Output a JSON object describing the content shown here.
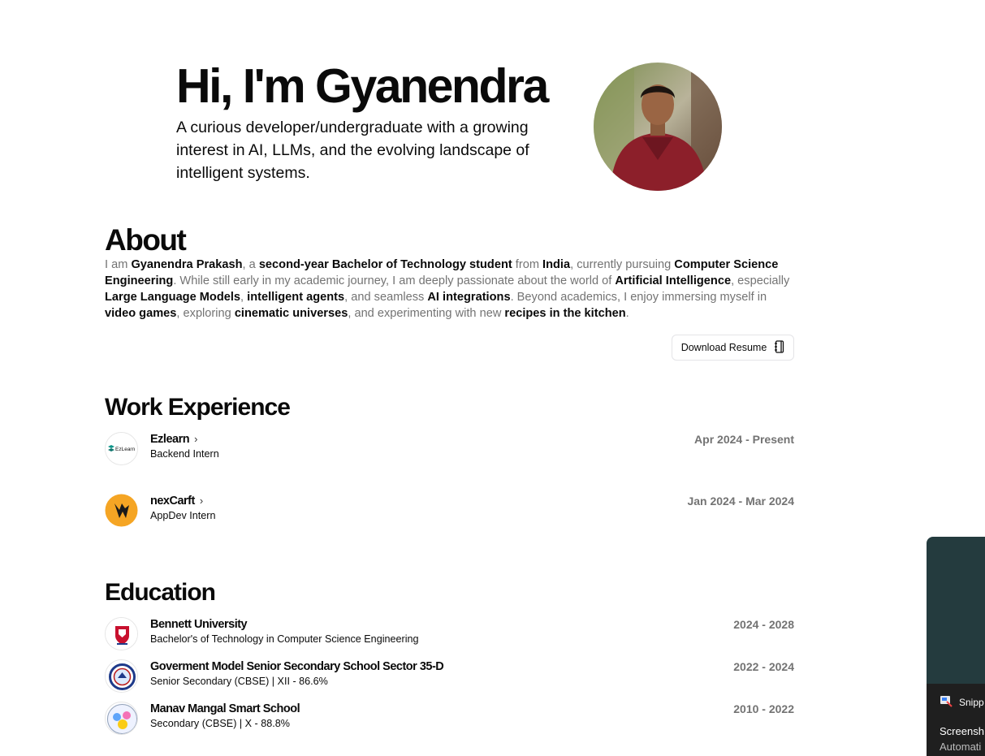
{
  "hero": {
    "title": "Hi, I'm Gyanendra",
    "subtitle": "A curious developer/undergraduate with a growing interest in AI, LLMs, and the evolving landscape of intelligent systems."
  },
  "about": {
    "title": "About",
    "segments": [
      {
        "text": "I am ",
        "bold": false
      },
      {
        "text": "Gyanendra Prakash",
        "bold": true
      },
      {
        "text": ", a ",
        "bold": false
      },
      {
        "text": "second-year Bachelor of Technology student",
        "bold": true
      },
      {
        "text": " from ",
        "bold": false
      },
      {
        "text": "India",
        "bold": true
      },
      {
        "text": ", currently pursuing ",
        "bold": false
      },
      {
        "text": "Computer Science Engineering",
        "bold": true
      },
      {
        "text": ". While still early in my academic journey, I am deeply passionate about the world of ",
        "bold": false
      },
      {
        "text": "Artificial Intelligence",
        "bold": true
      },
      {
        "text": ", especially ",
        "bold": false
      },
      {
        "text": "Large Language Models",
        "bold": true
      },
      {
        "text": ", ",
        "bold": false
      },
      {
        "text": "intelligent agents",
        "bold": true
      },
      {
        "text": ", and seamless ",
        "bold": false
      },
      {
        "text": "AI integrations",
        "bold": true
      },
      {
        "text": ". Beyond academics, I enjoy immersing myself in ",
        "bold": false
      },
      {
        "text": "video games",
        "bold": true
      },
      {
        "text": ", exploring ",
        "bold": false
      },
      {
        "text": "cinematic universes",
        "bold": true
      },
      {
        "text": ", and experimenting with new ",
        "bold": false
      },
      {
        "text": "recipes in the kitchen",
        "bold": true
      },
      {
        "text": ".",
        "bold": false
      }
    ],
    "resume_button": "Download Resume"
  },
  "work": {
    "title": "Work Experience",
    "items": [
      {
        "company": "Ezlearn",
        "role": "Backend Intern",
        "dates": "Apr 2024 - Present",
        "logo_text": "EzLearn"
      },
      {
        "company": "nexCarft",
        "role": "AppDev Intern",
        "dates": "Jan 2024 - Mar 2024"
      }
    ]
  },
  "education": {
    "title": "Education",
    "items": [
      {
        "school": "Bennett University",
        "degree": "Bachelor's of Technology in Computer Science Engineering",
        "dates": "2024 - 2028"
      },
      {
        "school": "Goverment Model Senior Secondary School Sector 35-D",
        "degree": "Senior Secondary (CBSE) | XII - 86.6%",
        "dates": "2022 - 2024"
      },
      {
        "school": "Manav Mangal Smart School",
        "degree": "Secondary (CBSE) | X - 88.8%",
        "dates": "2010 - 2022"
      }
    ]
  },
  "notification": {
    "app": "Snipp",
    "line1": "Screensh",
    "line2": "Automati"
  }
}
